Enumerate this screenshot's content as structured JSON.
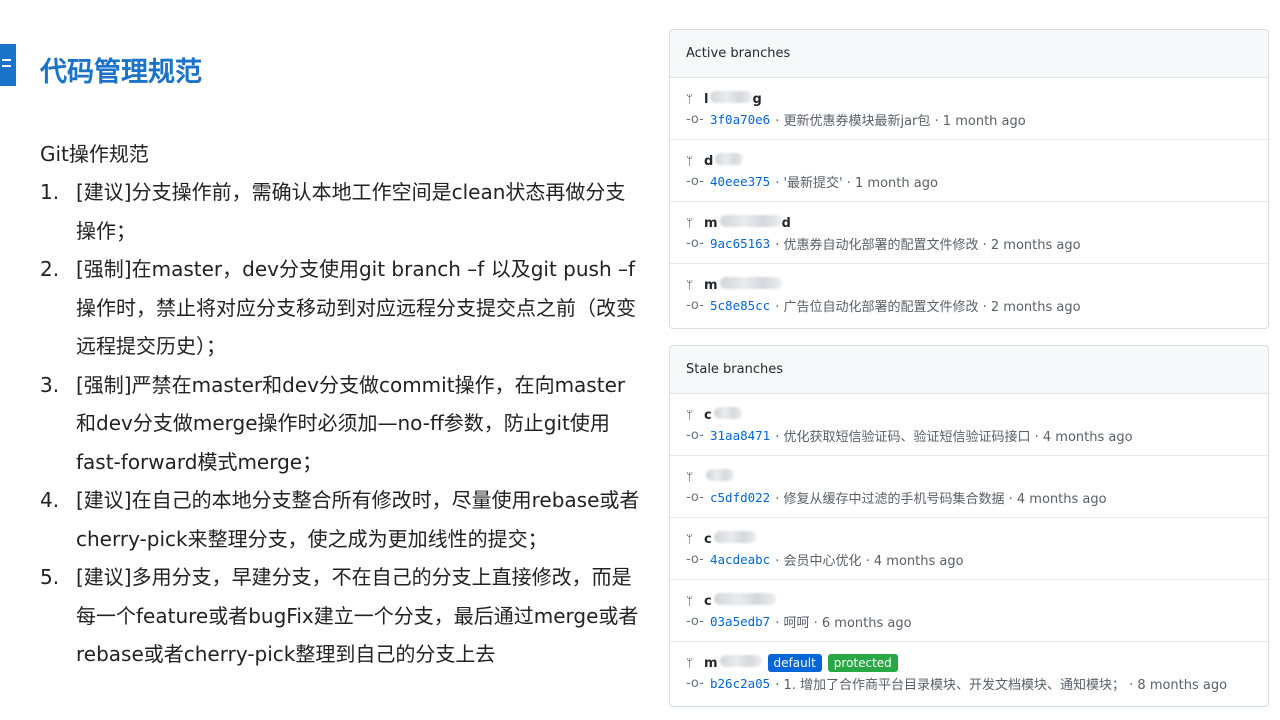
{
  "slide": {
    "title": "代码管理规范",
    "subtitle": "Git操作规范",
    "rules": [
      {
        "num": "1.",
        "text": "[建议]分支操作前，需确认本地工作空间是clean状态再做分支操作；"
      },
      {
        "num": "2.",
        "text": "[强制]在master，dev分支使用git  branch –f 以及git push –f 操作时，禁止将对应分支移动到对应远程分支提交点之前（改变远程提交历史）；"
      },
      {
        "num": "3.",
        "text": "[强制]严禁在master和dev分支做commit操作，在向master和dev分支做merge操作时必须加—no-ff参数，防止git使用fast-forward模式merge；"
      },
      {
        "num": "4.",
        "text": "[建议]在自己的本地分支整合所有修改时，尽量使用rebase或者cherry-pick来整理分支，使之成为更加线性的提交；"
      },
      {
        "num": "5.",
        "text": "[建议]多用分支，早建分支，不在自己的分支上直接修改，而是每一个feature或者bugFix建立一个分支，最后通过merge或者rebase或者cherry-pick整理到自己的分支上去"
      }
    ]
  },
  "active": {
    "header": "Active branches",
    "branches": [
      {
        "name_prefix": "l",
        "name_suffix": "g",
        "sha": "3f0a70e6",
        "message": "· 更新优惠券模块最新jar包 · 1 month ago"
      },
      {
        "name_prefix": "d",
        "name_suffix": "",
        "sha": "40eee375",
        "message": "· '最新提交' · 1 month ago"
      },
      {
        "name_prefix": "m",
        "name_suffix": "d",
        "sha": "9ac65163",
        "message": "· 优惠券自动化部署的配置文件修改 · 2 months ago"
      },
      {
        "name_prefix": "m",
        "name_suffix": "",
        "sha": "5c8e85cc",
        "message": "· 广告位自动化部署的配置文件修改 · 2 months ago"
      }
    ]
  },
  "stale": {
    "header": "Stale branches",
    "branches": [
      {
        "name_prefix": "c",
        "name_suffix": "",
        "sha": "31aa8471",
        "message": "· 优化获取短信验证码、验证短信验证码接口 · 4 months ago"
      },
      {
        "name_prefix": "",
        "name_suffix": "",
        "sha": "c5dfd022",
        "message": "· 修复从缓存中过滤的手机号码集合数据 · 4 months ago"
      },
      {
        "name_prefix": "c",
        "name_suffix": "",
        "sha": "4acdeabc",
        "message": "· 会员中心优化 · 4 months ago"
      },
      {
        "name_prefix": "c",
        "name_suffix": "",
        "sha": "03a5edb7",
        "message": "· 呵呵 · 6 months ago"
      },
      {
        "name_prefix": "m",
        "name_suffix": "",
        "sha": "b26c2a05",
        "message": "· 1. 增加了合作商平台目录模块、开发文档模块、通知模块；  · 8 months ago",
        "badge_default": "default",
        "badge_protected": "protected"
      }
    ]
  },
  "icons": {
    "branch": "branch-icon",
    "commit": "commit-icon",
    "title": "menu-icon"
  },
  "colors": {
    "accent": "#1a73c8",
    "link": "#0366d6",
    "default_badge": "#0366d6",
    "protected_badge": "#28a745"
  }
}
